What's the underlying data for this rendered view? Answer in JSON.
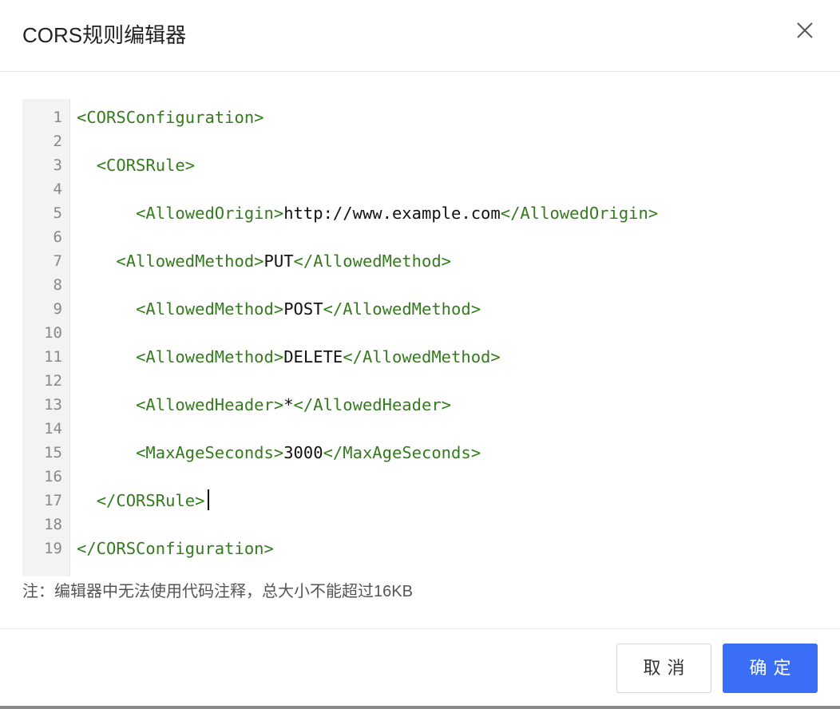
{
  "dialog": {
    "title": "CORS规则编辑器",
    "close_icon": "close-icon"
  },
  "editor": {
    "line_numbers": [
      "1",
      "2",
      "3",
      "4",
      "5",
      "6",
      "7",
      "8",
      "9",
      "10",
      "11",
      "12",
      "13",
      "14",
      "15",
      "16",
      "17",
      "18",
      "19"
    ],
    "lines": [
      {
        "indent": "",
        "open": "<CORSConfiguration>",
        "text": "",
        "close": ""
      },
      {
        "indent": "",
        "open": "",
        "text": "",
        "close": ""
      },
      {
        "indent": "  ",
        "open": "<CORSRule>",
        "text": "",
        "close": ""
      },
      {
        "indent": "",
        "open": "",
        "text": "",
        "close": ""
      },
      {
        "indent": "      ",
        "open": "<AllowedOrigin>",
        "text": "http://www.example.com",
        "close": "</AllowedOrigin>"
      },
      {
        "indent": "",
        "open": "",
        "text": "",
        "close": ""
      },
      {
        "indent": "    ",
        "open": "<AllowedMethod>",
        "text": "PUT",
        "close": "</AllowedMethod>"
      },
      {
        "indent": "",
        "open": "",
        "text": "",
        "close": ""
      },
      {
        "indent": "      ",
        "open": "<AllowedMethod>",
        "text": "POST",
        "close": "</AllowedMethod>"
      },
      {
        "indent": "",
        "open": "",
        "text": "",
        "close": ""
      },
      {
        "indent": "      ",
        "open": "<AllowedMethod>",
        "text": "DELETE",
        "close": "</AllowedMethod>"
      },
      {
        "indent": "",
        "open": "",
        "text": "",
        "close": ""
      },
      {
        "indent": "      ",
        "open": "<AllowedHeader>",
        "text": "*",
        "close": "</AllowedHeader>"
      },
      {
        "indent": "",
        "open": "",
        "text": "",
        "close": ""
      },
      {
        "indent": "      ",
        "open": "<MaxAgeSeconds>",
        "text": "3000",
        "close": "</MaxAgeSeconds>"
      },
      {
        "indent": "",
        "open": "",
        "text": "",
        "close": ""
      },
      {
        "indent": "  ",
        "open": "</CORSRule>",
        "text": "",
        "close": ""
      },
      {
        "indent": "",
        "open": "",
        "text": "",
        "close": ""
      },
      {
        "indent": "",
        "open": "</CORSConfiguration>",
        "text": "",
        "close": ""
      }
    ],
    "cursor_line": 17,
    "colors": {
      "tag": "#347b1d",
      "text": "#111111"
    }
  },
  "note": "注：编辑器中无法使用代码注释，总大小不能超过16KB",
  "footer": {
    "cancel_label": "取消",
    "ok_label": "确定",
    "ok_color": "#3a6ef6"
  }
}
